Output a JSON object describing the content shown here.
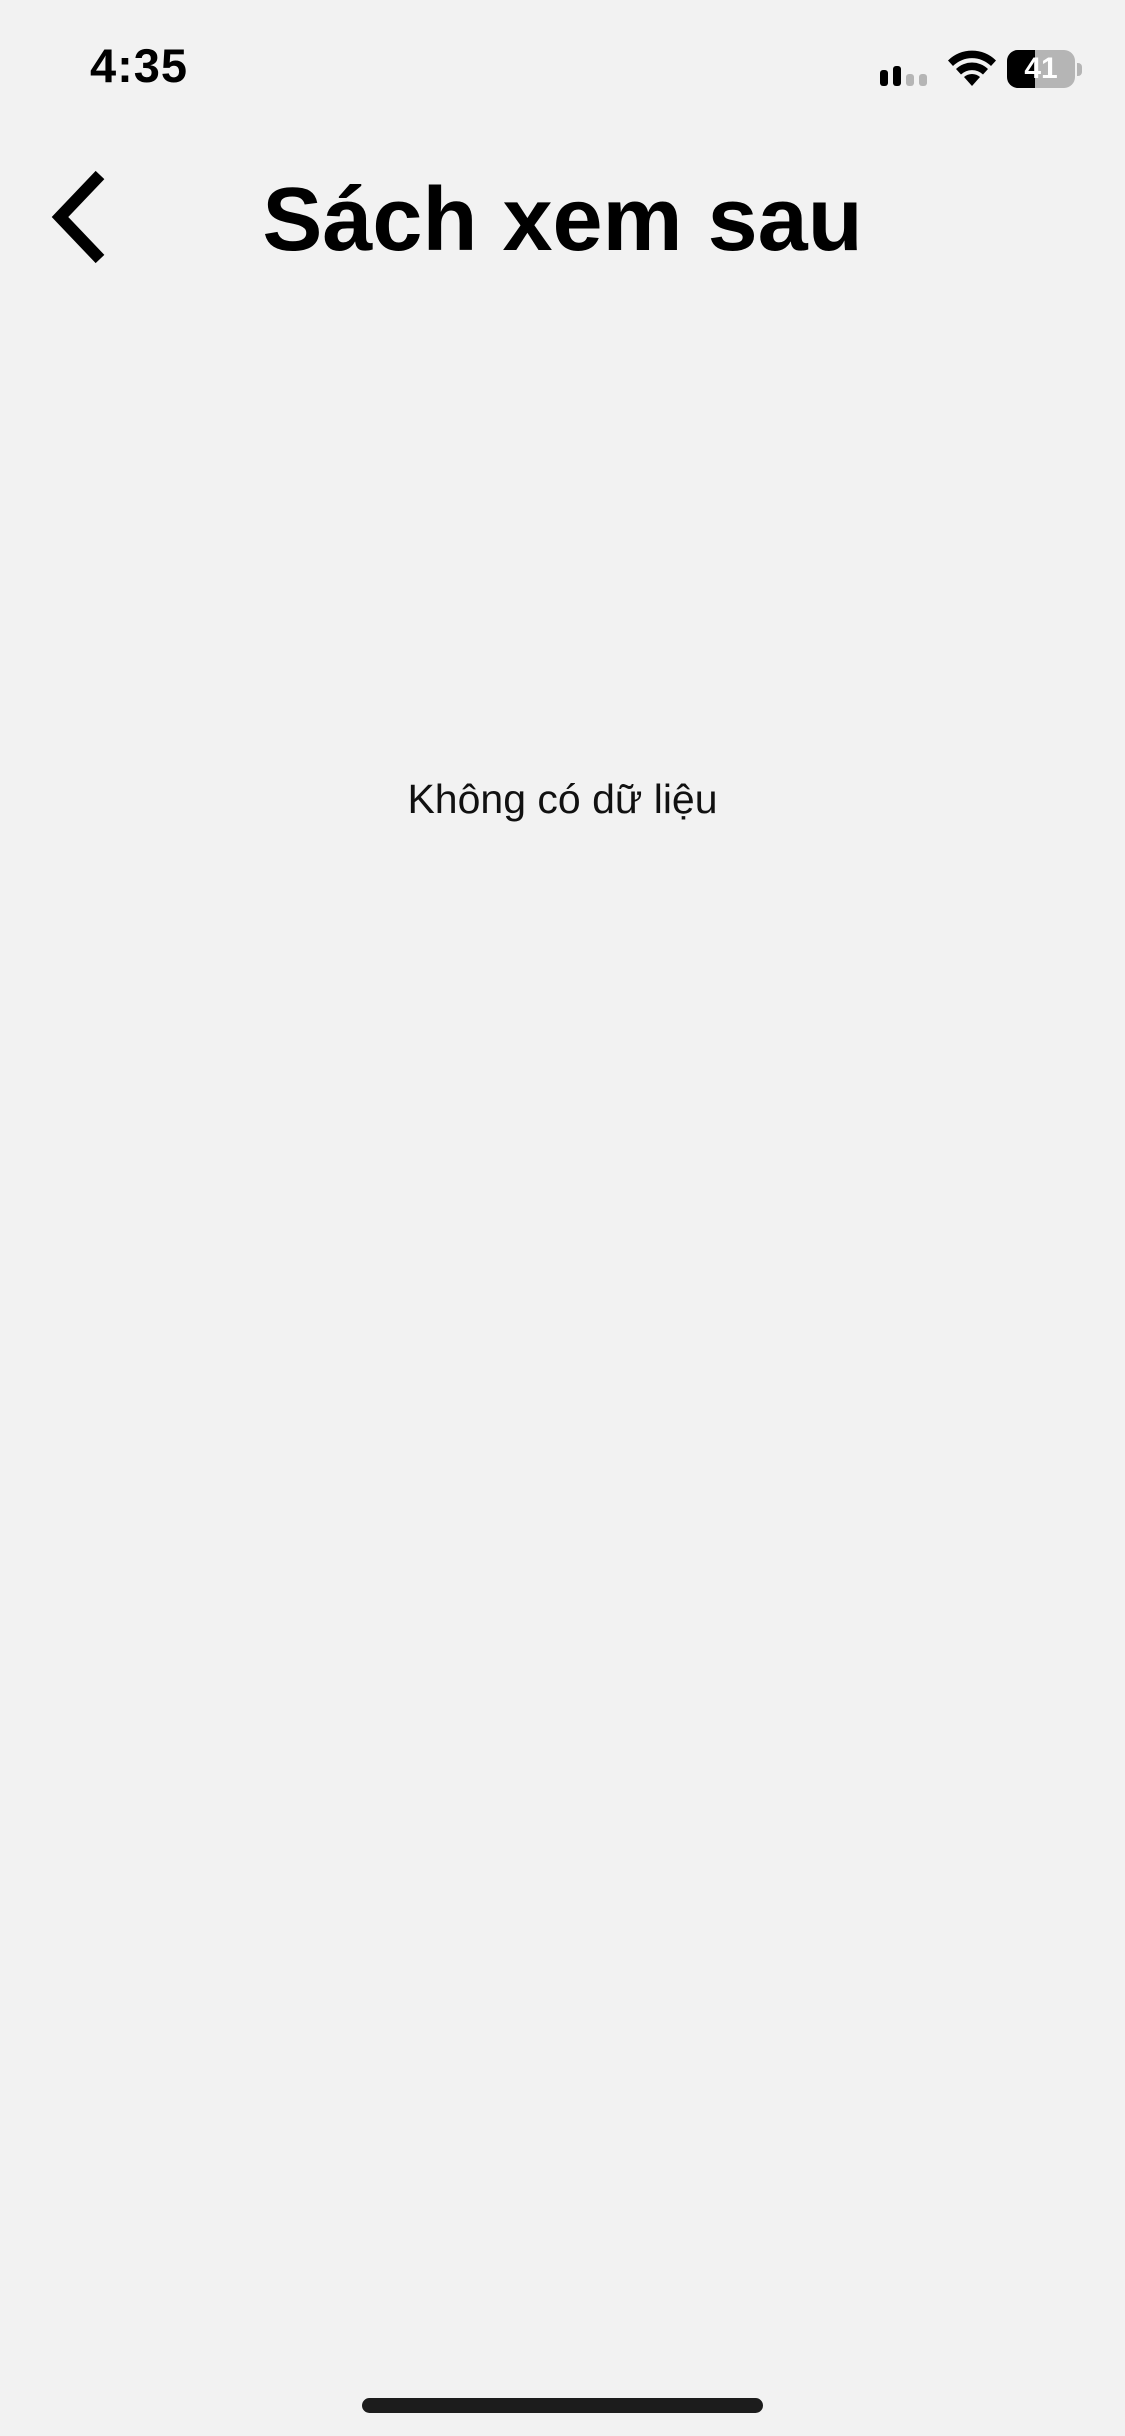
{
  "status_bar": {
    "time": "4:35",
    "battery_level": "41",
    "icons": [
      "cellular-signal-icon",
      "wifi-icon",
      "battery-icon"
    ]
  },
  "header": {
    "title": "Sách xem sau",
    "back_icon": "chevron-left-icon"
  },
  "main": {
    "empty_message": "Không có dữ liệu"
  },
  "colors": {
    "background": "#f2f2f2",
    "text": "#000000",
    "home_indicator": "#1c1c1c"
  }
}
